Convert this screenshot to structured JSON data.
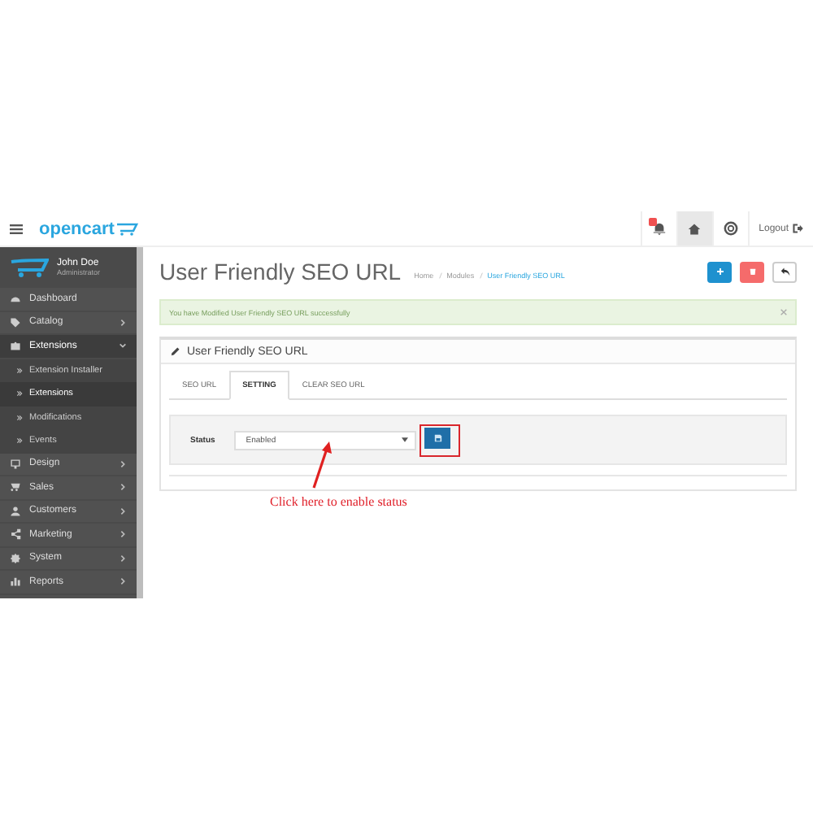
{
  "header": {
    "logo": "opencart",
    "logout": "Logout",
    "notifications": {
      "unread": true
    }
  },
  "user": {
    "name": "John Doe",
    "role": "Administrator"
  },
  "menu": [
    {
      "label": "Dashboard",
      "expandable": false,
      "selected": false
    },
    {
      "label": "Catalog",
      "expandable": true,
      "expanded": false,
      "selected": false
    },
    {
      "label": "Extensions",
      "expandable": true,
      "expanded": true,
      "selected": true,
      "children": [
        {
          "label": "Extension Installer",
          "selected": false
        },
        {
          "label": "Extensions",
          "selected": true
        },
        {
          "label": "Modifications",
          "selected": false
        },
        {
          "label": "Events",
          "selected": false
        }
      ]
    },
    {
      "label": "Design",
      "expandable": true,
      "expanded": false,
      "selected": false
    },
    {
      "label": "Sales",
      "expandable": true,
      "expanded": false,
      "selected": false
    },
    {
      "label": "Customers",
      "expandable": true,
      "expanded": false,
      "selected": false
    },
    {
      "label": "Marketing",
      "expandable": true,
      "expanded": false,
      "selected": false
    },
    {
      "label": "System",
      "expandable": true,
      "expanded": false,
      "selected": false
    },
    {
      "label": "Reports",
      "expandable": true,
      "expanded": false,
      "selected": false
    }
  ],
  "page": {
    "title": "User Friendly SEO URL",
    "breadcrumbs": [
      {
        "label": "Home",
        "current": false
      },
      {
        "label": "Modules",
        "current": false
      },
      {
        "label": "User Friendly SEO URL",
        "current": true
      }
    ]
  },
  "alert": {
    "text": "You have Modified User Friendly SEO URL successfully"
  },
  "panel": {
    "title": "User Friendly SEO URL",
    "tabs": [
      {
        "label": "SEO URL",
        "selected": false
      },
      {
        "label": "SETTING",
        "selected": true
      },
      {
        "label": "CLEAR SEO URL",
        "selected": false
      }
    ],
    "form": {
      "label": "Status",
      "value": "Enabled"
    }
  },
  "annotation": {
    "text": "Click here to enable status"
  }
}
